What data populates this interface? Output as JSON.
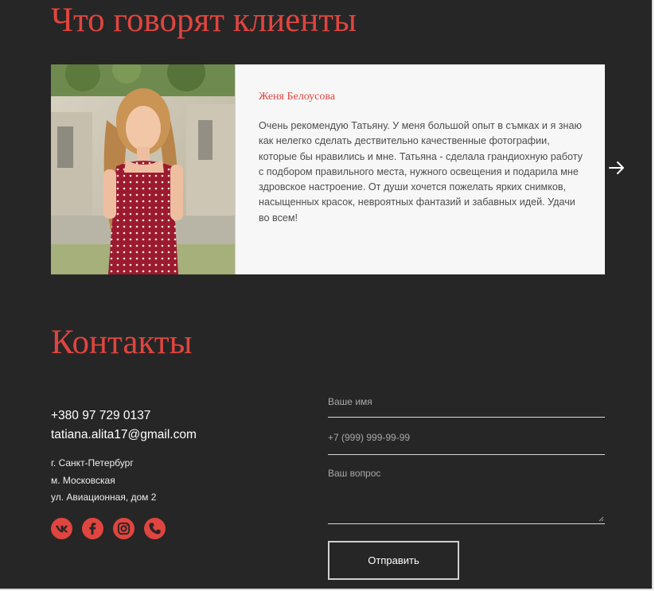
{
  "reviews": {
    "title": "Что говорят клиенты",
    "card": {
      "name": "Женя Белоусова",
      "text": "Очень рекомендую Татьяну. У меня большой опыт в съмках и я знаю как нелегко сделать дествительно качественные фотографии, которые бы нравились и мне. Татьяна - сделала грандиохную работу с подбором правильного места, нужного освещения и подарила мне здровское настроение. От души хочется пожелать ярких снимков, насыщенных красок, невроятных фантазий и забавных идей. Удачи во всем!"
    },
    "next_icon": "arrow-right-icon"
  },
  "contacts": {
    "title": "Контакты",
    "phone": "+380 97 729 0137",
    "email": "tatiana.alita17@gmail.com",
    "address": [
      "г. Санкт-Петербург",
      "м. Московская",
      "ул. Авиационная, дом 2"
    ],
    "social": [
      "vk-icon",
      "facebook-icon",
      "instagram-icon",
      "phone-icon"
    ]
  },
  "form": {
    "name_placeholder": "Ваше имя",
    "phone_placeholder": "+7 (999) 999-99-99",
    "question_placeholder": "Ваш вопрос",
    "submit_label": "Отправить"
  },
  "colors": {
    "background": "#272626",
    "accent": "#e0453f",
    "card": "#f7f7f7"
  }
}
